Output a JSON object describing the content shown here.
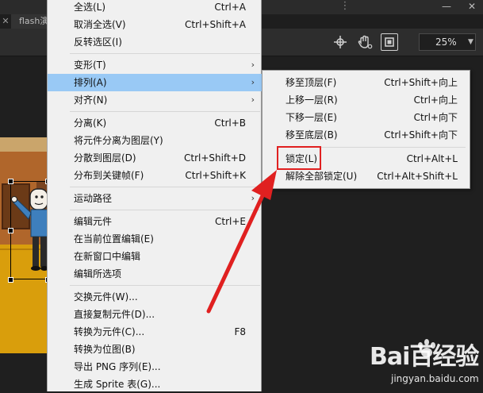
{
  "document_tab": {
    "title": "flash演"
  },
  "toolbar": {
    "zoom_value": "25%"
  },
  "context_menu": {
    "items": [
      {
        "label": "全选(L)",
        "shortcut": "Ctrl+A"
      },
      {
        "label": "取消全选(V)",
        "shortcut": "Ctrl+Shift+A"
      },
      {
        "label": "反转选区(I)",
        "shortcut": ""
      },
      {
        "label": "变形(T)",
        "shortcut": ""
      },
      {
        "label": "排列(A)",
        "shortcut": ""
      },
      {
        "label": "对齐(N)",
        "shortcut": ""
      },
      {
        "label": "分离(K)",
        "shortcut": "Ctrl+B"
      },
      {
        "label": "将元件分离为图层(Y)",
        "shortcut": ""
      },
      {
        "label": "分散到图层(D)",
        "shortcut": "Ctrl+Shift+D"
      },
      {
        "label": "分布到关键帧(F)",
        "shortcut": "Ctrl+Shift+K"
      },
      {
        "label": "运动路径",
        "shortcut": ""
      },
      {
        "label": "编辑元件",
        "shortcut": "Ctrl+E"
      },
      {
        "label": "在当前位置编辑(E)",
        "shortcut": ""
      },
      {
        "label": "在新窗口中编辑",
        "shortcut": ""
      },
      {
        "label": "编辑所选项",
        "shortcut": ""
      },
      {
        "label": "交换元件(W)...",
        "shortcut": ""
      },
      {
        "label": "直接复制元件(D)...",
        "shortcut": ""
      },
      {
        "label": "转换为元件(C)...",
        "shortcut": "F8"
      },
      {
        "label": "转换为位图(B)",
        "shortcut": ""
      },
      {
        "label": "导出 PNG 序列(E)...",
        "shortcut": ""
      },
      {
        "label": "生成 Sprite 表(G)...",
        "shortcut": ""
      }
    ]
  },
  "arrange_submenu": {
    "items": [
      {
        "label": "移至顶层(F)",
        "shortcut": "Ctrl+Shift+向上"
      },
      {
        "label": "上移一层(R)",
        "shortcut": "Ctrl+向上"
      },
      {
        "label": "下移一层(E)",
        "shortcut": "Ctrl+向下"
      },
      {
        "label": "移至底层(B)",
        "shortcut": "Ctrl+Shift+向下"
      },
      {
        "label": "锁定(L)",
        "shortcut": "Ctrl+Alt+L"
      },
      {
        "label": "解除全部锁定(U)",
        "shortcut": "Ctrl+Alt+Shift+L"
      }
    ]
  },
  "watermark": {
    "brand": "Bai百经验",
    "url": "jingyan.baidu.com"
  },
  "colors": {
    "highlight": "#99c9f5",
    "annotation": "#e02020",
    "menu_bg": "#f0f0f0"
  },
  "icons": [
    "close-icon",
    "kebab-icon",
    "minimize-icon",
    "close-window-icon",
    "crosshair-icon",
    "hand-icon",
    "clip-icon",
    "chevron-down-icon",
    "submenu-arrow-icon"
  ]
}
